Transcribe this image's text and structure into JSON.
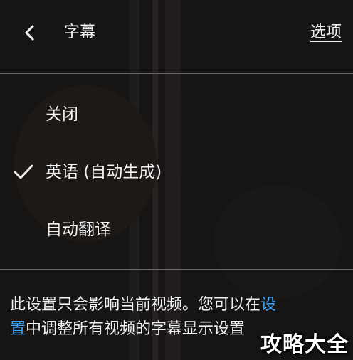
{
  "header": {
    "back_icon": "chevron-left-icon",
    "title": "字幕",
    "options_label": "选项"
  },
  "menu": {
    "items": [
      {
        "label": "关闭",
        "selected": false
      },
      {
        "label": "英语 (自动生成)",
        "selected": true
      },
      {
        "label": "自动翻译",
        "selected": false
      }
    ],
    "check_icon": "checkmark-icon"
  },
  "footer": {
    "text_before": "此设置只会影响当前视频。您可以在",
    "link_part1": "设",
    "link_part2": "置",
    "text_after": "中调整所有视频的字幕显示设置"
  },
  "watermark": "攻略大全",
  "colors": {
    "text": "#f1f1f1",
    "link": "#3ea6ff",
    "divider": "#6a6866",
    "background": "#1c1a19"
  }
}
